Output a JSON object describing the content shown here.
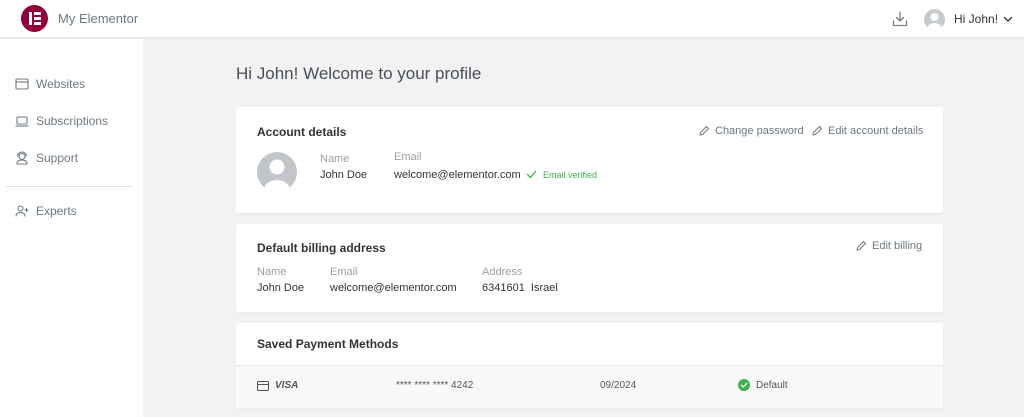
{
  "app": {
    "title": "My Elementor",
    "logo_icon": "elementor-logo-icon",
    "brand_color": "#92003b"
  },
  "header": {
    "download_icon": "download-icon",
    "user_greeting": "Hi John!",
    "chevron_icon": "chevron-down-icon"
  },
  "sidebar": {
    "items": [
      {
        "label": "Websites",
        "icon": "browser-window-icon"
      },
      {
        "label": "Subscriptions",
        "icon": "laptop-icon"
      },
      {
        "label": "Support",
        "icon": "support-agent-icon"
      },
      {
        "label": "Experts",
        "icon": "add-person-icon"
      }
    ]
  },
  "page": {
    "title": "Hi John! Welcome to your profile"
  },
  "account": {
    "title": "Account details",
    "change_password": "Change password",
    "edit_details": "Edit account details",
    "name_label": "Name",
    "name": "John Doe",
    "email_label": "Email",
    "email": "welcome@elementor.com",
    "verified_text": "Email verified",
    "verified_color": "#39b54a"
  },
  "billing": {
    "title": "Default billing address",
    "edit": "Edit billing",
    "name_label": "Name",
    "name": "John Doe",
    "email_label": "Email",
    "email": "welcome@elementor.com",
    "address_label": "Address",
    "address": "6341601  Israel"
  },
  "payment": {
    "title": "Saved Payment Methods",
    "methods": [
      {
        "brand": "VISA",
        "card_icon": "credit-card-icon",
        "number": "**** **** **** 4242",
        "expiry": "09/2024",
        "status": "Default",
        "status_icon": "check-circle-icon"
      }
    ]
  }
}
